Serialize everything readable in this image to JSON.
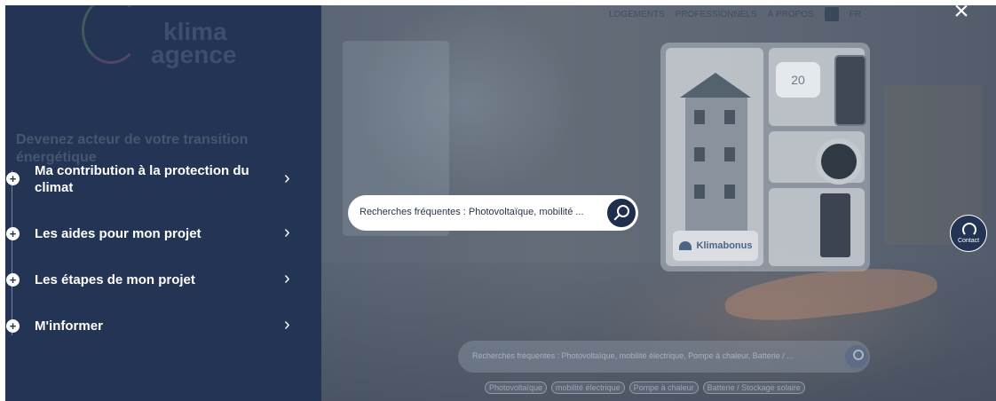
{
  "top_nav": {
    "links": [
      "LOGEMENTS",
      "PROFESSIONNELS",
      "À PROPOS"
    ],
    "language": "FR"
  },
  "brand": {
    "logo_line1": "klima",
    "logo_line2": "agence",
    "tagline": "Devenez acteur de votre transition énergétique"
  },
  "menu": {
    "items": [
      {
        "label": "Ma contribution à la protection du climat"
      },
      {
        "label": "Les aides pour mon projet"
      },
      {
        "label": "Les étapes de mon projet"
      },
      {
        "label": "M'informer"
      }
    ]
  },
  "search": {
    "placeholder": "Recherches fréquentes : Photovoltaïque, mobilité ..."
  },
  "bottom_search": {
    "placeholder": "Recherches fréquentes : Photovoltaïque, mobilité électrique, Pompe à chaleur, Batterie / ...",
    "chips": [
      "Photovoltaïque",
      "mobilité électrique",
      "Pompe à chaleur",
      "Batterie / Stockage solaire"
    ]
  },
  "hero": {
    "thermostat_display": "20",
    "badge": "Klimabonus"
  },
  "contact": {
    "label": "Contact"
  },
  "icons": {
    "close": "close-icon",
    "search": "search-icon",
    "contact": "headset-icon",
    "menu_expand": "plus-icon",
    "menu_chevron": "chevron-right-icon"
  },
  "colors": {
    "sidebar": "#243454",
    "accent": "#1f2e4c",
    "text_light": "#ffffff"
  }
}
